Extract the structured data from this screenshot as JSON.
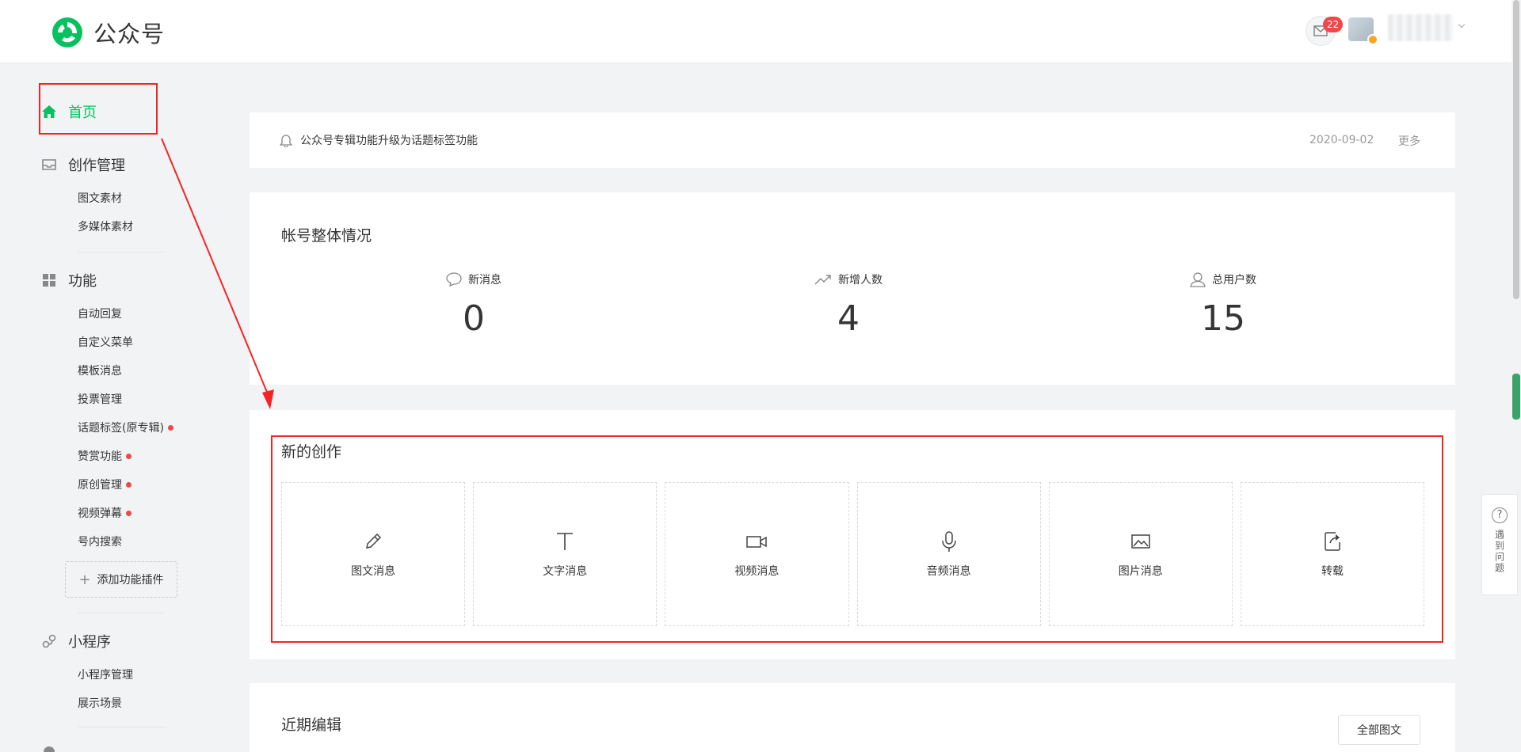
{
  "header": {
    "logo_text": "公众号",
    "mail_badge": "22"
  },
  "sidebar": {
    "home": "首页",
    "sections": {
      "creation": {
        "title": "创作管理",
        "items": [
          "图文素材",
          "多媒体素材"
        ]
      },
      "features": {
        "title": "功能",
        "items": [
          "自动回复",
          "自定义菜单",
          "模板消息",
          "投票管理",
          "话题标签(原专辑)",
          "赞赏功能",
          "原创管理",
          "视频弹幕",
          "号内搜索"
        ]
      },
      "miniprogram": {
        "title": "小程序",
        "items": [
          "小程序管理",
          "展示场景"
        ]
      }
    },
    "add_plugin": "添加功能插件"
  },
  "notice": {
    "text": "公众号专辑功能升级为话题标签功能",
    "date": "2020-09-02",
    "more": "更多"
  },
  "overview": {
    "title": "帐号整体情况",
    "stats": [
      {
        "label": "新消息",
        "value": "0",
        "icon": "chat-bubble-icon"
      },
      {
        "label": "新增人数",
        "value": "4",
        "icon": "trend-up-icon"
      },
      {
        "label": "总用户数",
        "value": "15",
        "icon": "user-icon"
      }
    ]
  },
  "create": {
    "title": "新的创作",
    "tiles": [
      {
        "label": "图文消息",
        "icon": "pencil-icon"
      },
      {
        "label": "文字消息",
        "icon": "text-icon"
      },
      {
        "label": "视频消息",
        "icon": "video-icon"
      },
      {
        "label": "音频消息",
        "icon": "microphone-icon"
      },
      {
        "label": "图片消息",
        "icon": "image-icon"
      },
      {
        "label": "转载",
        "icon": "share-icon"
      }
    ]
  },
  "recent": {
    "title": "近期编辑",
    "all_button": "全部图文"
  },
  "help": {
    "text": "遇到问题"
  },
  "colors": {
    "accent": "#07c160",
    "highlight": "#f42424",
    "badge": "#f04848"
  }
}
